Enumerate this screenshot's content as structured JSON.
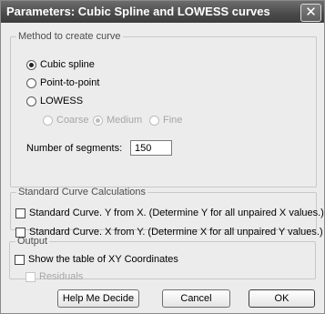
{
  "dialog": {
    "title": "Parameters: Cubic Spline and LOWESS curves",
    "close_symbol": "✕"
  },
  "method": {
    "legend": "Method to create curve",
    "options": [
      {
        "label": "Cubic spline",
        "selected": true
      },
      {
        "label": "Point-to-point",
        "selected": false
      },
      {
        "label": "LOWESS",
        "selected": false
      }
    ],
    "smoothing": [
      {
        "label": "Coarse",
        "selected": false
      },
      {
        "label": "Medium",
        "selected": true
      },
      {
        "label": "Fine",
        "selected": false
      }
    ],
    "segments_label": "Number of segments:",
    "segments_value": "150"
  },
  "standard_curve": {
    "legend": "Standard Curve Calculations",
    "y_from_x": "Standard Curve. Y from X. (Determine Y for all unpaired X values.)",
    "x_from_y": "Standard Curve. X from Y. (Determine X for all unpaired Y values.)"
  },
  "output": {
    "legend": "Output",
    "show_table": "Show the table of XY Coordinates",
    "residuals": "Residuals"
  },
  "buttons": {
    "help": "Help Me Decide",
    "cancel": "Cancel",
    "ok": "OK"
  }
}
